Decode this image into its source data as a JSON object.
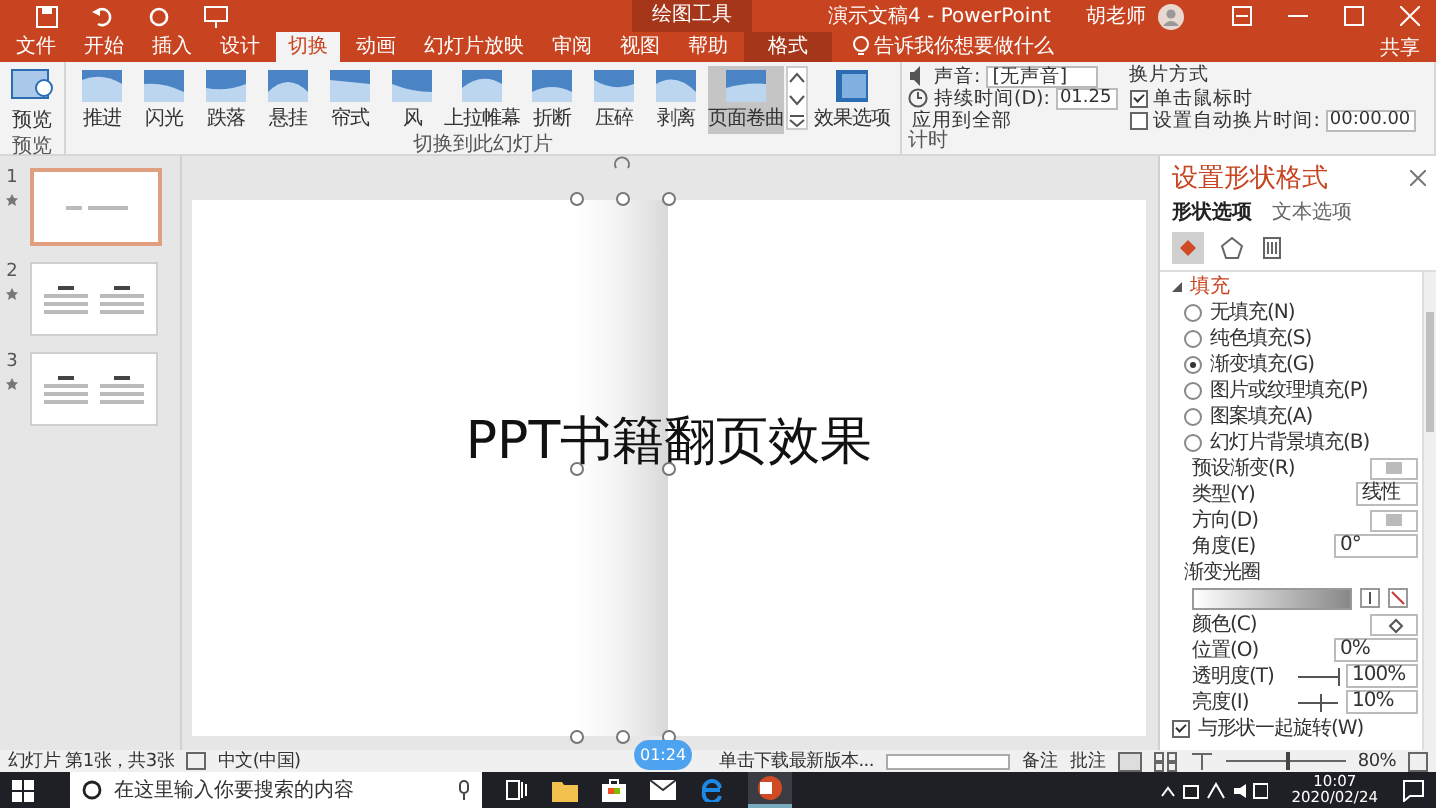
{
  "titlebar": {
    "context_label": "绘图工具",
    "title": "演示文稿4 - PowerPoint",
    "user": "胡老师"
  },
  "ribbon_tabs": [
    {
      "label": "文件",
      "selected": false,
      "contextual": false
    },
    {
      "label": "开始",
      "selected": false,
      "contextual": false
    },
    {
      "label": "插入",
      "selected": false,
      "contextual": false
    },
    {
      "label": "设计",
      "selected": false,
      "contextual": false
    },
    {
      "label": "切换",
      "selected": true,
      "contextual": false
    },
    {
      "label": "动画",
      "selected": false,
      "contextual": false
    },
    {
      "label": "幻灯片放映",
      "selected": false,
      "contextual": false
    },
    {
      "label": "审阅",
      "selected": false,
      "contextual": false
    },
    {
      "label": "视图",
      "selected": false,
      "contextual": false
    },
    {
      "label": "帮助",
      "selected": false,
      "contextual": false
    },
    {
      "label": "格式",
      "selected": false,
      "contextual": true
    }
  ],
  "tell_me": "告诉我你想要做什么",
  "share": "共享",
  "preview_button": "预览",
  "transitions": [
    {
      "label": "推进",
      "selected": false
    },
    {
      "label": "闪光",
      "selected": false
    },
    {
      "label": "跌落",
      "selected": false
    },
    {
      "label": "悬挂",
      "selected": false
    },
    {
      "label": "帘式",
      "selected": false
    },
    {
      "label": "风",
      "selected": false
    },
    {
      "label": "上拉帷幕",
      "selected": false
    },
    {
      "label": "折断",
      "selected": false
    },
    {
      "label": "压碎",
      "selected": false
    },
    {
      "label": "剥离",
      "selected": false
    },
    {
      "label": "页面卷曲",
      "selected": true
    }
  ],
  "effect_options": "效果选项",
  "sound": {
    "label": "声音:",
    "value": "[无声音]"
  },
  "duration": {
    "label": "持续时间(D):",
    "value": "01.25"
  },
  "apply_all": "应用到全部",
  "advance": {
    "title": "换片方式",
    "options": [
      {
        "label": "单击鼠标时",
        "checked": true
      },
      {
        "label": "设置自动换片时间:",
        "checked": false,
        "value": "00:00.00"
      }
    ]
  },
  "group_labels": {
    "preview": "预览",
    "transition": "切换到此幻灯片",
    "timing": "计时"
  },
  "slides": [
    {
      "number": "1",
      "selected": true,
      "kind": "title"
    },
    {
      "number": "2",
      "selected": false,
      "kind": "text"
    },
    {
      "number": "3",
      "selected": false,
      "kind": "text"
    }
  ],
  "slide": {
    "text": "PPT书籍翻页效果"
  },
  "recording_badge": "01:24",
  "format_pane": {
    "title": "设置形状格式",
    "tabs": [
      {
        "label": "形状选项",
        "selected": true
      },
      {
        "label": "文本选项",
        "selected": false
      }
    ],
    "section": "填充",
    "fill_options": [
      {
        "label": "无填充(N)",
        "selected": false
      },
      {
        "label": "纯色填充(S)",
        "selected": false
      },
      {
        "label": "渐变填充(G)",
        "selected": true
      },
      {
        "label": "图片或纹理填充(P)",
        "selected": false
      },
      {
        "label": "图案填充(A)",
        "selected": false
      },
      {
        "label": "幻灯片背景填充(B)",
        "selected": false
      }
    ],
    "fields": [
      {
        "kind": "swatch",
        "label": "预设渐变(R)"
      },
      {
        "kind": "dropdown",
        "label": "类型(Y)",
        "value": "线性"
      },
      {
        "kind": "swatch",
        "label": "方向(D)"
      },
      {
        "kind": "spin",
        "label": "角度(E)",
        "value": "0°"
      },
      {
        "kind": "stops",
        "label": "渐变光圈"
      },
      {
        "kind": "color",
        "label": "颜色(C)"
      },
      {
        "kind": "spin",
        "label": "位置(O)",
        "value": "0%"
      },
      {
        "kind": "slider",
        "label": "透明度(T)",
        "value": "100%",
        "level": 1
      },
      {
        "kind": "slider",
        "label": "亮度(I)",
        "value": "10%",
        "level": 0.55
      }
    ],
    "rotate_with_shape": {
      "label": "与形状一起旋转(W)",
      "checked": true
    }
  },
  "status_bar": {
    "slide_info": "幻灯片 第1张，共3张",
    "language": "中文(中国)",
    "download": "单击下载最新版本...",
    "notes": "备注",
    "comments": "批注",
    "zoom": "80%",
    "download_progress": {
      "level": 0
    },
    "zoom_slider": {
      "level": 0.5
    }
  },
  "taskbar": {
    "search": "在这里输入你要搜索的内容",
    "time": "10:07",
    "date": "2020/02/24"
  }
}
